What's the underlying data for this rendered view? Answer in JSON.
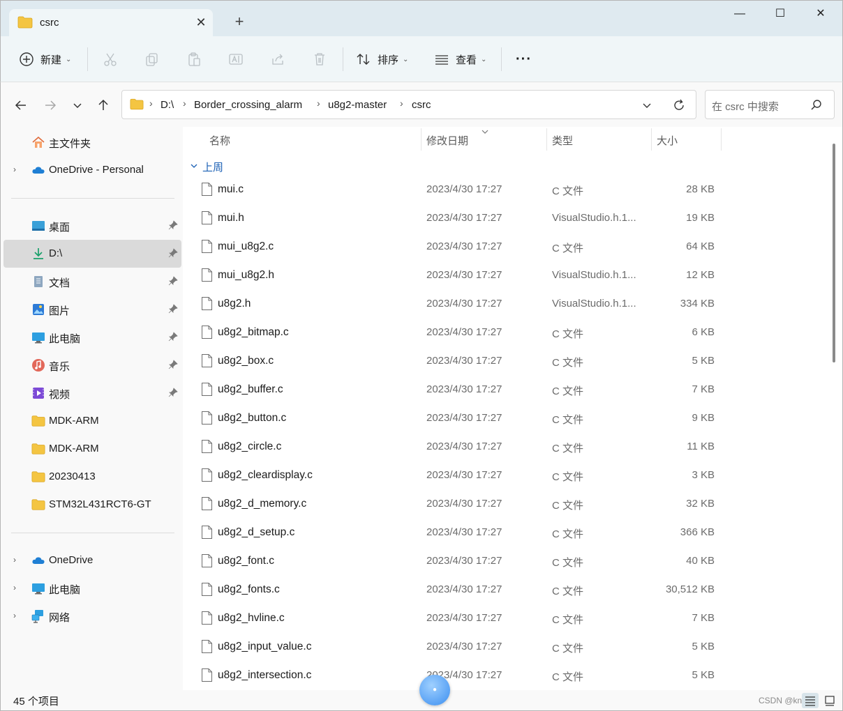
{
  "window": {
    "tab_title": "csrc",
    "tab_close": "✕",
    "new_tab": "+",
    "minimize": "—",
    "maximize": "☐",
    "close": "✕"
  },
  "toolbar": {
    "new_label": "新建",
    "sort_label": "排序",
    "view_label": "查看",
    "more_label": "···"
  },
  "address": {
    "crumbs": [
      "D:\\",
      "Border_crossing_alarm",
      "u8g2-master",
      "csrc"
    ],
    "search_placeholder": "在 csrc 中搜索"
  },
  "sidebar": {
    "items": [
      {
        "label": "主文件夹"
      },
      {
        "label": "OneDrive - Personal"
      },
      {
        "label": "桌面"
      },
      {
        "label": "D:\\"
      },
      {
        "label": "文档"
      },
      {
        "label": "图片"
      },
      {
        "label": "此电脑"
      },
      {
        "label": "音乐"
      },
      {
        "label": "视频"
      },
      {
        "label": "MDK-ARM"
      },
      {
        "label": "MDK-ARM"
      },
      {
        "label": "20230413"
      },
      {
        "label": "STM32L431RCT6-GT"
      },
      {
        "label": "OneDrive"
      },
      {
        "label": "此电脑"
      },
      {
        "label": "网络"
      }
    ]
  },
  "columns": {
    "name": "名称",
    "date": "修改日期",
    "type": "类型",
    "size": "大小"
  },
  "group_label": "上周",
  "files": [
    {
      "name": "mui.c",
      "date": "2023/4/30 17:27",
      "type": "C 文件",
      "size": "28 KB"
    },
    {
      "name": "mui.h",
      "date": "2023/4/30 17:27",
      "type": "VisualStudio.h.1...",
      "size": "19 KB"
    },
    {
      "name": "mui_u8g2.c",
      "date": "2023/4/30 17:27",
      "type": "C 文件",
      "size": "64 KB"
    },
    {
      "name": "mui_u8g2.h",
      "date": "2023/4/30 17:27",
      "type": "VisualStudio.h.1...",
      "size": "12 KB"
    },
    {
      "name": "u8g2.h",
      "date": "2023/4/30 17:27",
      "type": "VisualStudio.h.1...",
      "size": "334 KB"
    },
    {
      "name": "u8g2_bitmap.c",
      "date": "2023/4/30 17:27",
      "type": "C 文件",
      "size": "6 KB"
    },
    {
      "name": "u8g2_box.c",
      "date": "2023/4/30 17:27",
      "type": "C 文件",
      "size": "5 KB"
    },
    {
      "name": "u8g2_buffer.c",
      "date": "2023/4/30 17:27",
      "type": "C 文件",
      "size": "7 KB"
    },
    {
      "name": "u8g2_button.c",
      "date": "2023/4/30 17:27",
      "type": "C 文件",
      "size": "9 KB"
    },
    {
      "name": "u8g2_circle.c",
      "date": "2023/4/30 17:27",
      "type": "C 文件",
      "size": "11 KB"
    },
    {
      "name": "u8g2_cleardisplay.c",
      "date": "2023/4/30 17:27",
      "type": "C 文件",
      "size": "3 KB"
    },
    {
      "name": "u8g2_d_memory.c",
      "date": "2023/4/30 17:27",
      "type": "C 文件",
      "size": "32 KB"
    },
    {
      "name": "u8g2_d_setup.c",
      "date": "2023/4/30 17:27",
      "type": "C 文件",
      "size": "366 KB"
    },
    {
      "name": "u8g2_font.c",
      "date": "2023/4/30 17:27",
      "type": "C 文件",
      "size": "40 KB"
    },
    {
      "name": "u8g2_fonts.c",
      "date": "2023/4/30 17:27",
      "type": "C 文件",
      "size": "30,512 KB"
    },
    {
      "name": "u8g2_hvline.c",
      "date": "2023/4/30 17:27",
      "type": "C 文件",
      "size": "7 KB"
    },
    {
      "name": "u8g2_input_value.c",
      "date": "2023/4/30 17:27",
      "type": "C 文件",
      "size": "5 KB"
    },
    {
      "name": "u8g2_intersection.c",
      "date": "2023/4/30 17:27",
      "type": "C 文件",
      "size": "5 KB"
    }
  ],
  "status": {
    "item_count": "45 个项目",
    "watermark": "CSDN @kn..."
  },
  "colors": {
    "accent": "#1a5fb4",
    "folder": "#f4c542",
    "titlebar": "#dfeaf0"
  }
}
